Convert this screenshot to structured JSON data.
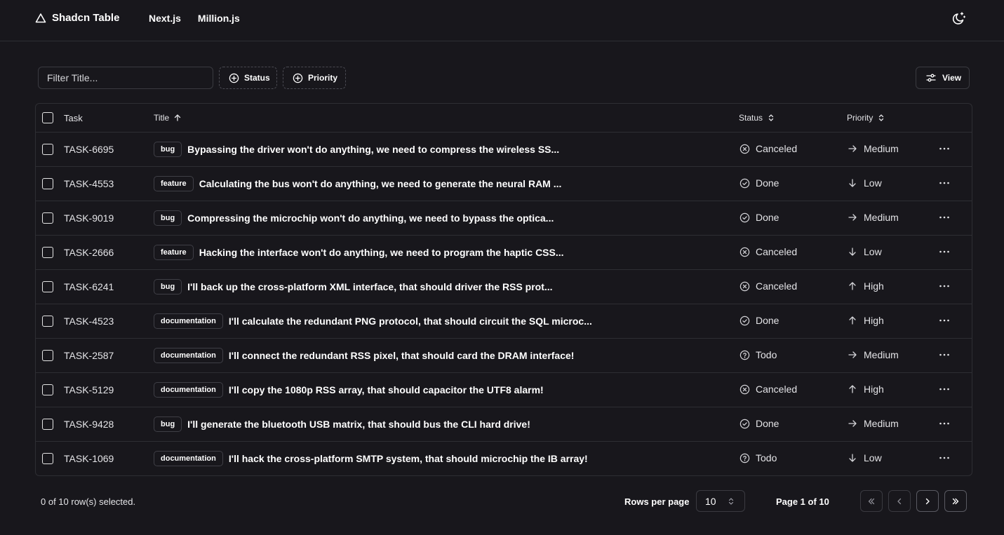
{
  "app": {
    "brand": "Shadcn Table",
    "nav": [
      "Next.js",
      "Million.js"
    ]
  },
  "toolbar": {
    "filter_placeholder": "Filter Title...",
    "status_label": "Status",
    "priority_label": "Priority",
    "view_label": "View"
  },
  "table": {
    "columns": {
      "task": "Task",
      "title": "Title",
      "status": "Status",
      "priority": "Priority"
    },
    "rows": [
      {
        "task": "TASK-6695",
        "label": "bug",
        "title": "Bypassing the driver won't do anything, we need to compress the wireless SS...",
        "status": "Canceled",
        "status_icon": "x-circle-icon",
        "priority": "Medium",
        "priority_icon": "arrow-right-icon"
      },
      {
        "task": "TASK-4553",
        "label": "feature",
        "title": "Calculating the bus won't do anything, we need to generate the neural RAM ...",
        "status": "Done",
        "status_icon": "check-circle-icon",
        "priority": "Low",
        "priority_icon": "arrow-down-icon"
      },
      {
        "task": "TASK-9019",
        "label": "bug",
        "title": "Compressing the microchip won't do anything, we need to bypass the optica...",
        "status": "Done",
        "status_icon": "check-circle-icon",
        "priority": "Medium",
        "priority_icon": "arrow-right-icon"
      },
      {
        "task": "TASK-2666",
        "label": "feature",
        "title": "Hacking the interface won't do anything, we need to program the haptic CSS...",
        "status": "Canceled",
        "status_icon": "x-circle-icon",
        "priority": "Low",
        "priority_icon": "arrow-down-icon"
      },
      {
        "task": "TASK-6241",
        "label": "bug",
        "title": "I'll back up the cross-platform XML interface, that should driver the RSS prot...",
        "status": "Canceled",
        "status_icon": "x-circle-icon",
        "priority": "High",
        "priority_icon": "arrow-up-icon"
      },
      {
        "task": "TASK-4523",
        "label": "documentation",
        "title": "I'll calculate the redundant PNG protocol, that should circuit the SQL microc...",
        "status": "Done",
        "status_icon": "check-circle-icon",
        "priority": "High",
        "priority_icon": "arrow-up-icon"
      },
      {
        "task": "TASK-2587",
        "label": "documentation",
        "title": "I'll connect the redundant RSS pixel, that should card the DRAM interface!",
        "status": "Todo",
        "status_icon": "help-circle-icon",
        "priority": "Medium",
        "priority_icon": "arrow-right-icon"
      },
      {
        "task": "TASK-5129",
        "label": "documentation",
        "title": "I'll copy the 1080p RSS array, that should capacitor the UTF8 alarm!",
        "status": "Canceled",
        "status_icon": "x-circle-icon",
        "priority": "High",
        "priority_icon": "arrow-up-icon"
      },
      {
        "task": "TASK-9428",
        "label": "bug",
        "title": "I'll generate the bluetooth USB matrix, that should bus the CLI hard drive!",
        "status": "Done",
        "status_icon": "check-circle-icon",
        "priority": "Medium",
        "priority_icon": "arrow-right-icon"
      },
      {
        "task": "TASK-1069",
        "label": "documentation",
        "title": "I'll hack the cross-platform SMTP system, that should microchip the IB array!",
        "status": "Todo",
        "status_icon": "help-circle-icon",
        "priority": "Low",
        "priority_icon": "arrow-down-icon"
      }
    ]
  },
  "footer": {
    "selected_text": "0 of 10 row(s) selected.",
    "rows_per_page_label": "Rows per page",
    "rows_per_page_value": "10",
    "page_label": "Page 1 of 10"
  }
}
